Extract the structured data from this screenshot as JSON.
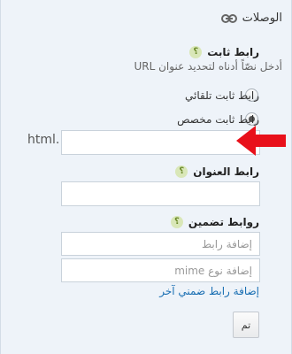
{
  "header": {
    "title": "الوصلات",
    "icon": "link-icon"
  },
  "permalink": {
    "title": "رابط ثابت",
    "description": "أدخل نصّاً أدناه لتحديد عنوان URL",
    "options": [
      {
        "label": "رابط ثابت تلقائي",
        "selected": false
      },
      {
        "label": "رابط ثابت مخصص",
        "selected": true
      }
    ],
    "input_value": "",
    "suffix": "html."
  },
  "title_link": {
    "title": "رابط العنوان",
    "input_value": ""
  },
  "enclosures": {
    "title": "روابط تضمين",
    "link_placeholder": "إضافة رابط",
    "mime_placeholder": "إضافة نوع mime",
    "add_another": "إضافة رابط ضمني آخر"
  },
  "done_button": {
    "label": "تم"
  },
  "help_glyph": "؟",
  "colors": {
    "arrow": "#e8101a",
    "link": "#1a6fb3",
    "help_bg": "#d9e7b8"
  }
}
